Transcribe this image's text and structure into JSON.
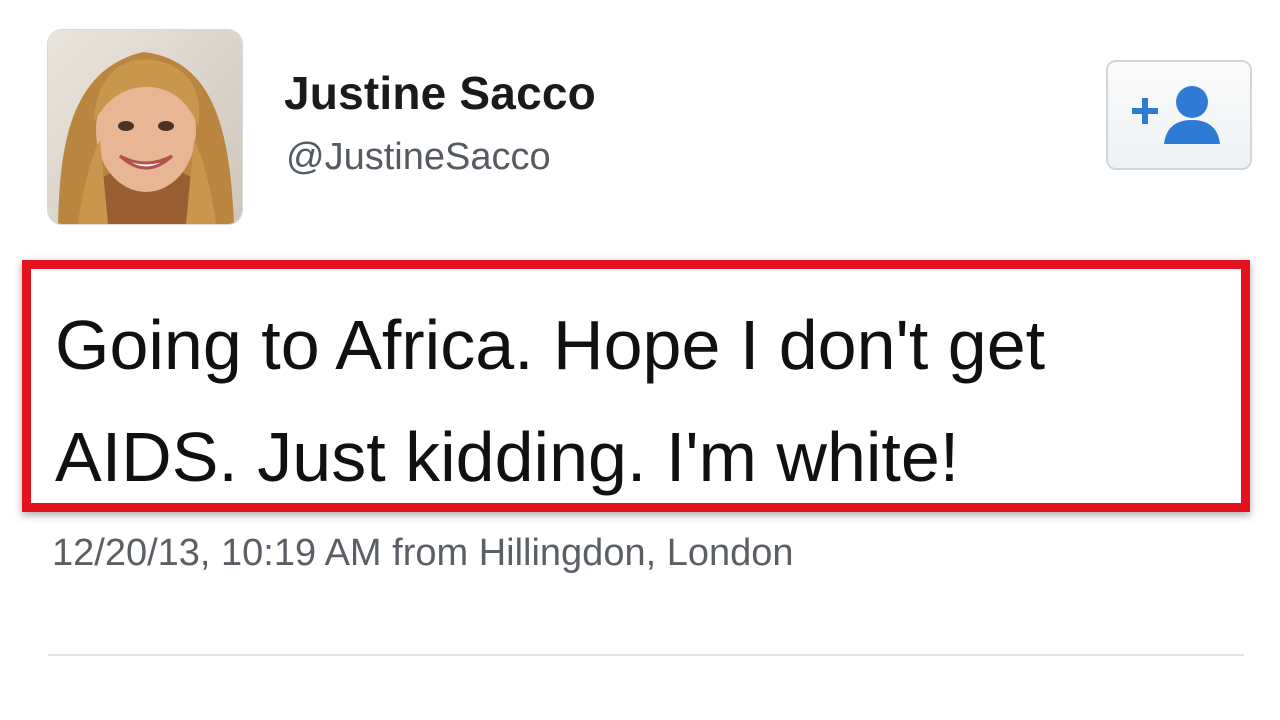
{
  "tweet": {
    "author": {
      "display_name": "Justine Sacco",
      "handle": "@JustineSacco",
      "avatar": "profile-photo"
    },
    "follow_button": {
      "icon": "add-user-icon",
      "icon_color": "#2e7bd6"
    },
    "text": "Going to Africa. Hope I don't get\nAIDS. Just kidding. I'm white!",
    "timestamp": "12/20/13, 10:19 AM from Hillingdon, London",
    "highlight_color": "#e3121c"
  }
}
